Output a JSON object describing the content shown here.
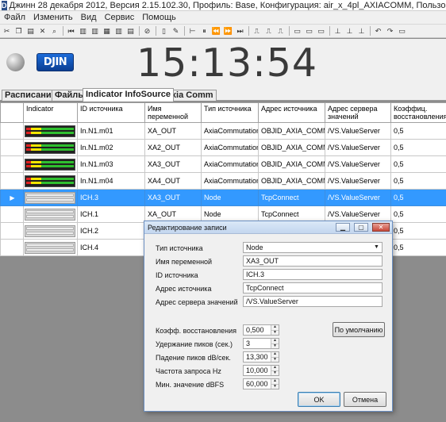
{
  "window": {
    "title": "Джинн 28 декабря 2012, Версия 2.15.102.30, Профиль: Base, Конфигурация: air_x_4pl_AXIACOMM, Пользователь: Admin, Отладочная версия!",
    "app_icon": "D"
  },
  "menu": [
    "Файл",
    "Изменить",
    "Вид",
    "Сервис",
    "Помощь"
  ],
  "clock": {
    "time": "15:13:54",
    "logo": "DJIN",
    "status_led_color": "#a0a0a0"
  },
  "tabs": [
    {
      "label": "Расписание",
      "active": false
    },
    {
      "label": "Файлы",
      "active": false
    },
    {
      "label": "Indicator InfoSource",
      "active": true
    },
    {
      "label": "Axia Comm",
      "active": false
    }
  ],
  "grid": {
    "columns": [
      "Indicator",
      "ID источника",
      "Имя переменной",
      "Тип источника",
      "Адрес источника",
      "Адрес сервера значений",
      "Коэффиц. восстановления"
    ],
    "rows": [
      {
        "marker": "",
        "indicator": "active",
        "id": "In.N1.m01",
        "var": "XA_OUT",
        "type": "AxiaCommutation",
        "addr": "OBJID_AXIA_COMM...",
        "server": "/VS.ValueServer",
        "coef": "0,5",
        "selected": false
      },
      {
        "marker": "",
        "indicator": "active",
        "id": "In.N1.m02",
        "var": "XA2_OUT",
        "type": "AxiaCommutation",
        "addr": "OBJID_AXIA_COMM...",
        "server": "/VS.ValueServer",
        "coef": "0,5",
        "selected": false
      },
      {
        "marker": "",
        "indicator": "active",
        "id": "In.N1.m03",
        "var": "XA3_OUT",
        "type": "AxiaCommutation",
        "addr": "OBJID_AXIA_COMM...",
        "server": "/VS.ValueServer",
        "coef": "0,5",
        "selected": false
      },
      {
        "marker": "",
        "indicator": "active",
        "id": "In.N1.m04",
        "var": "XA4_OUT",
        "type": "AxiaCommutation",
        "addr": "OBJID_AXIA_COMM...",
        "server": "/VS.ValueServer",
        "coef": "0,5",
        "selected": false
      },
      {
        "marker": "▶",
        "indicator": "idle",
        "id": "ICH.3",
        "var": "XA3_OUT",
        "type": "Node",
        "addr": "TcpConnect",
        "server": "/VS.ValueServer",
        "coef": "0,5",
        "selected": true
      },
      {
        "marker": "",
        "indicator": "idle",
        "id": "ICH.1",
        "var": "XA_OUT",
        "type": "Node",
        "addr": "TcpConnect",
        "server": "/VS.ValueServer",
        "coef": "0,5",
        "selected": false
      },
      {
        "marker": "",
        "indicator": "idle",
        "id": "ICH.2",
        "var": "",
        "type": "",
        "addr": "",
        "server": "",
        "coef": "0,5",
        "selected": false
      },
      {
        "marker": "",
        "indicator": "idle",
        "id": "ICH.4",
        "var": "",
        "type": "",
        "addr": "",
        "server": "",
        "coef": "0,5",
        "selected": false
      }
    ]
  },
  "dialog": {
    "title": "Редактирование записи",
    "fields": {
      "source_type_label": "Тип источника",
      "source_type_value": "Node",
      "var_name_label": "Имя переменной",
      "var_name_value": "XA3_OUT",
      "source_id_label": "ID источника",
      "source_id_value": "ICH.3",
      "source_addr_label": "Адрес источника",
      "source_addr_value": "TcpConnect",
      "server_addr_label": "Адрес сервера значений",
      "server_addr_value": "/VS.ValueServer"
    },
    "spinners": {
      "recovery_label": "Коэфф. восстановления",
      "recovery_value": "0,500",
      "peak_hold_label": "Удержание пиков (сек.)",
      "peak_hold_value": "3",
      "peak_fall_label": "Падение пиков dB/сек.",
      "peak_fall_value": "13,300",
      "poll_rate_label": "Частота запроса Hz",
      "poll_rate_value": "10,000",
      "min_dbfs_label": "Мин. значение dBFS",
      "min_dbfs_value": "60,000"
    },
    "buttons": {
      "default": "По умолчанию",
      "ok": "OK",
      "cancel": "Отмена"
    }
  },
  "colors": {
    "selection": "#3399ff",
    "meter_green": "#2fbf2f",
    "meter_yellow": "#f2e600",
    "meter_red": "#e02020"
  }
}
